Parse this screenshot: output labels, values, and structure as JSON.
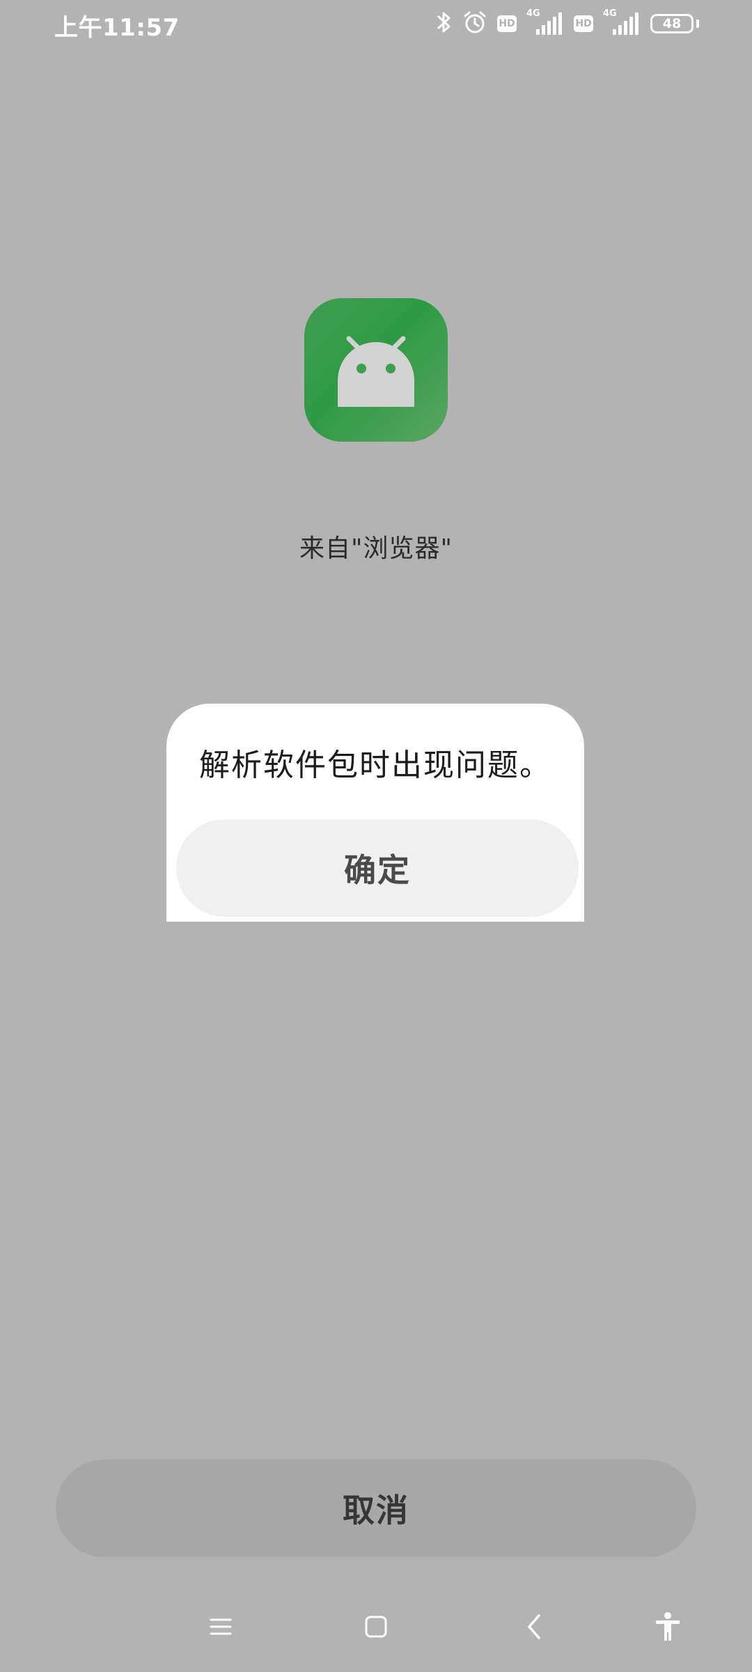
{
  "status_bar": {
    "time": "上午11:57",
    "icons": [
      "bluetooth-icon",
      "alarm-icon",
      "hd-badge",
      "signal-icon",
      "hd-badge",
      "signal-icon",
      "battery-icon"
    ],
    "hd_label": "HD",
    "network_1": "4G",
    "network_2": "4G",
    "battery_level": "48"
  },
  "app": {
    "icon": "android-icon",
    "icon_color": "#3f9e51",
    "source_label": "来自\"浏览器\""
  },
  "dialog": {
    "message": "解析软件包时出现问题。",
    "confirm_label": "确定"
  },
  "footer": {
    "cancel_label": "取消"
  },
  "nav_bar": {
    "icons": [
      "menu-icon",
      "home-icon",
      "back-icon",
      "accessibility-icon"
    ]
  }
}
